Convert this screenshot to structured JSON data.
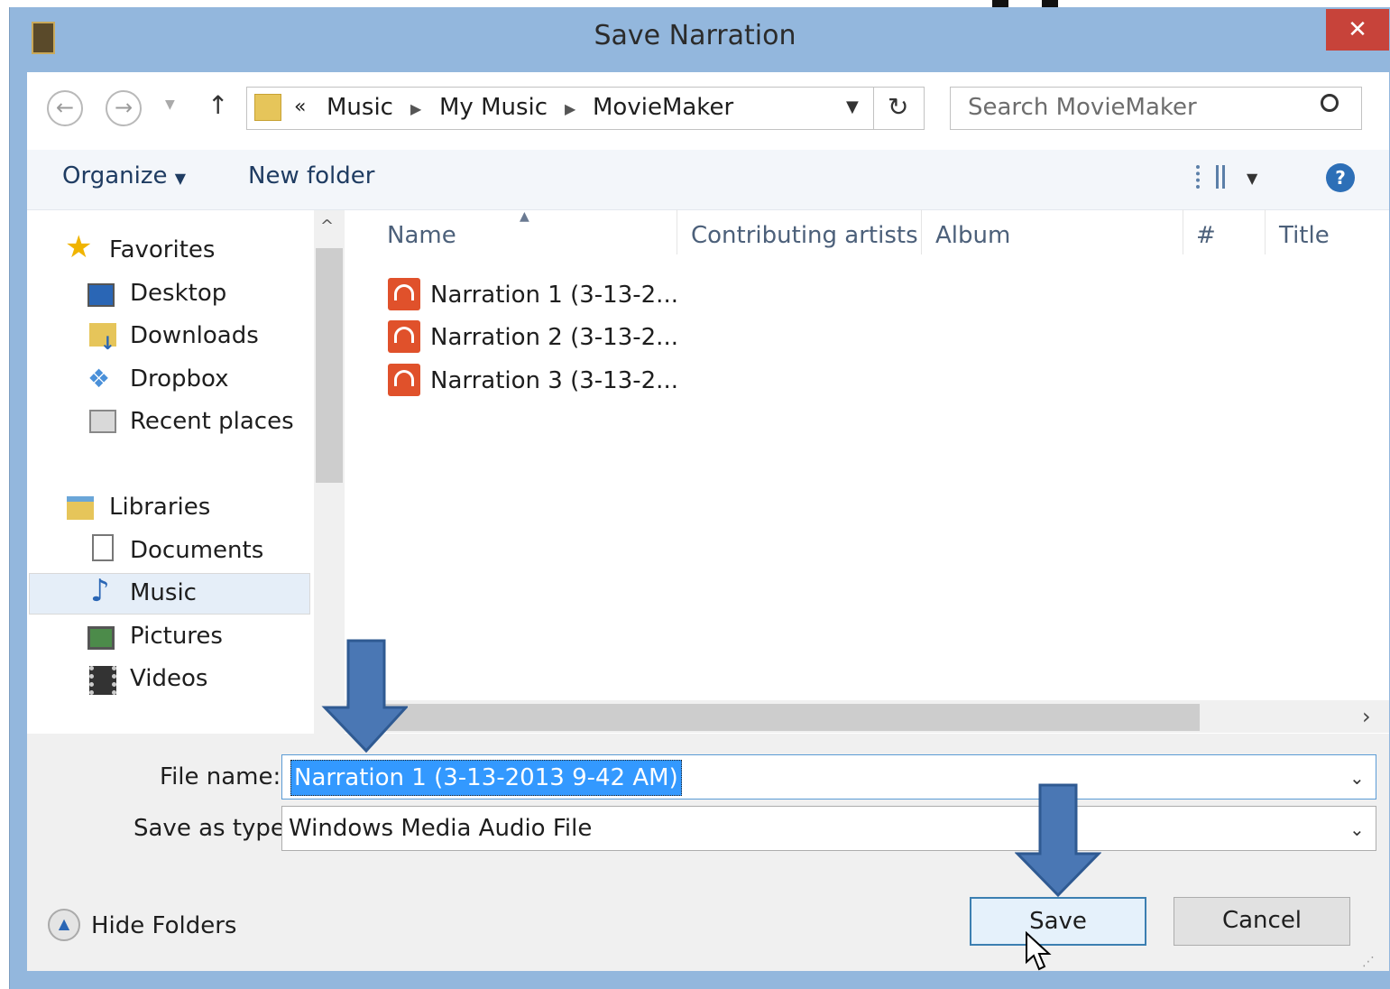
{
  "window": {
    "title": "Save Narration",
    "close_glyph": "✕"
  },
  "address": {
    "overflow": "«",
    "crumbs": [
      "Music",
      "My Music",
      "MovieMaker"
    ],
    "search_placeholder": "Search MovieMaker"
  },
  "toolbar": {
    "organize": "Organize",
    "new_folder": "New folder"
  },
  "nav": {
    "favorites": "Favorites",
    "fav_items": [
      "Desktop",
      "Downloads",
      "Dropbox",
      "Recent places"
    ],
    "libraries": "Libraries",
    "lib_items": [
      "Documents",
      "Music",
      "Pictures",
      "Videos"
    ]
  },
  "columns": [
    "Name",
    "Contributing artists",
    "Album",
    "#",
    "Title"
  ],
  "files": [
    "Narration 1 (3-13-2...",
    "Narration 2 (3-13-2...",
    "Narration 3 (3-13-2..."
  ],
  "form": {
    "file_name_label": "File name:",
    "file_name_value": "Narration 1 (3-13-2013 9-42 AM)",
    "save_type_label": "Save as type:",
    "save_type_value": "Windows Media Audio File"
  },
  "footer": {
    "hide_folders": "Hide Folders",
    "save": "Save",
    "cancel": "Cancel"
  },
  "colors": {
    "frame": "#93b7dd",
    "close": "#c7433a",
    "arrow": "#4a77b4",
    "selection": "#3399ff",
    "file_icon": "#e0512b"
  },
  "icons": [
    "back-icon",
    "forward-icon",
    "up-icon",
    "folder-icon",
    "refresh-icon",
    "search-icon",
    "view-icon",
    "help-icon",
    "star-icon",
    "desktop-icon",
    "downloads-icon",
    "dropbox-icon",
    "recent-places-icon",
    "libraries-icon",
    "documents-icon",
    "music-icon",
    "pictures-icon",
    "videos-icon",
    "audio-file-icon",
    "hide-folders-icon",
    "cursor-icon"
  ]
}
